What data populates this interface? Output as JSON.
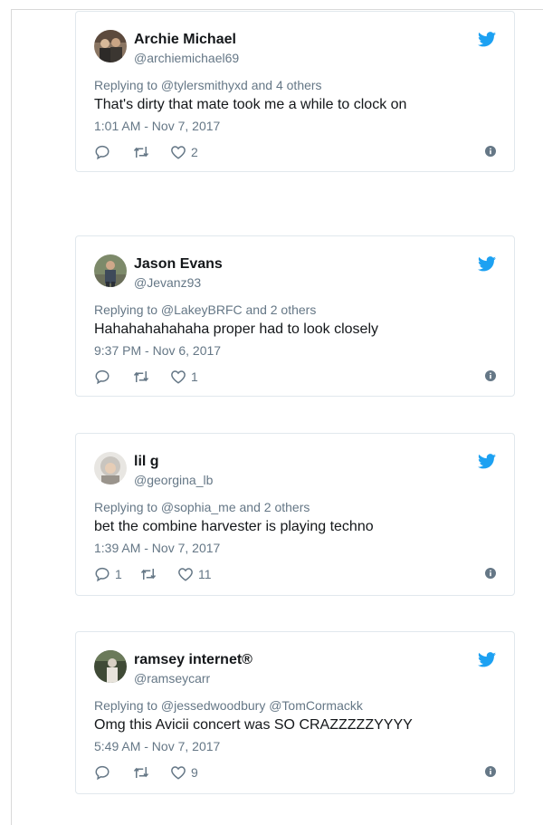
{
  "colors": {
    "twitter_blue": "#1da1f2",
    "text": "#14171a",
    "muted": "#657786",
    "border": "#e1e8ed"
  },
  "tweets": [
    {
      "name": "Archie Michael",
      "handle": "@archiemichael69",
      "replying": "Replying to @tylersmithyxd and 4 others",
      "text": "That's dirty that mate took me a while to clock on",
      "time": "1:01 AM - Nov 7, 2017",
      "replies": "",
      "retweets": "",
      "likes": "2",
      "icons": [
        "reply-icon",
        "retweet-icon",
        "heart-icon",
        "info-icon",
        "twitter-bird-icon"
      ]
    },
    {
      "name": "Jason Evans",
      "handle": "@Jevanz93",
      "replying": "Replying to @LakeyBRFC and 2 others",
      "text": "Hahahahahahaha proper had to look closely",
      "time": "9:37 PM - Nov 6, 2017",
      "replies": "",
      "retweets": "",
      "likes": "1",
      "icons": [
        "reply-icon",
        "retweet-icon",
        "heart-icon",
        "info-icon",
        "twitter-bird-icon"
      ]
    },
    {
      "name": "lil g",
      "handle": "@georgina_lb",
      "replying": "Replying to @sophia_me and 2 others",
      "text": "bet the combine harvester is playing techno",
      "time": "1:39 AM - Nov 7, 2017",
      "replies": "1",
      "retweets": "",
      "likes": "11",
      "icons": [
        "reply-icon",
        "retweet-icon",
        "heart-icon",
        "info-icon",
        "twitter-bird-icon"
      ]
    },
    {
      "name": "ramsey internet®",
      "handle": "@ramseycarr",
      "replying": "Replying to @jessedwoodbury @TomCormackk",
      "text": "Omg this Avicii concert was SO CRAZZZZZYYYY",
      "time": "5:49 AM - Nov 7, 2017",
      "replies": "",
      "retweets": "",
      "likes": "9",
      "icons": [
        "reply-icon",
        "retweet-icon",
        "heart-icon",
        "info-icon",
        "twitter-bird-icon"
      ]
    }
  ]
}
